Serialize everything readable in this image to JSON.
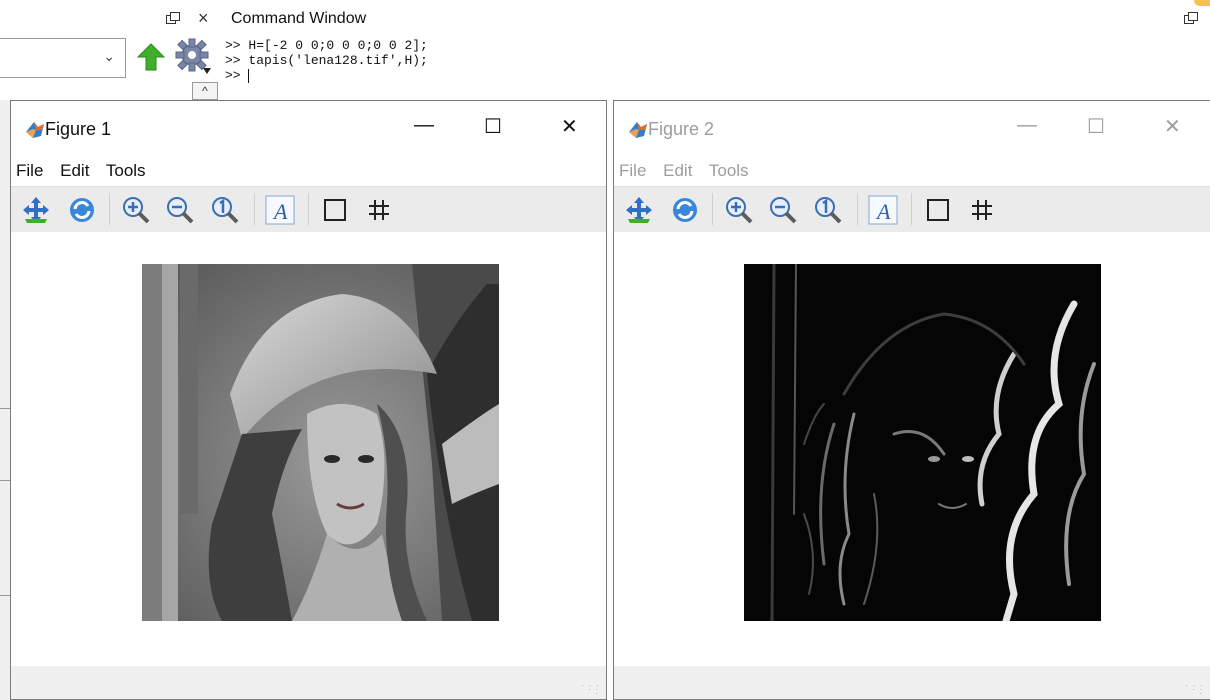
{
  "command_window": {
    "title": "Command Window",
    "close_glyph": "×",
    "lines": [
      "H=[-2 0 0;0 0 0;0 0 2];",
      "tapis('lena128.tif',H);",
      ""
    ],
    "prompt": ">>",
    "scroll_up_glyph": "^",
    "dropdown_glyph": "⌄"
  },
  "figures": [
    {
      "title": "Figure 1",
      "active": true,
      "menu": [
        "File",
        "Edit",
        "Tools"
      ],
      "image": {
        "name": "lena-original",
        "tone": "grayscale"
      }
    },
    {
      "title": "Figure 2",
      "active": false,
      "menu": [
        "File",
        "Edit",
        "Tools"
      ],
      "image": {
        "name": "lena-filtered",
        "tone": "edge-response"
      }
    }
  ],
  "window_controls": {
    "minimize": "—",
    "maximize": "☐",
    "close": "✕"
  },
  "toolbar_icons": [
    "pan-icon",
    "rotate-icon",
    "zoom-in-icon",
    "zoom-out-icon",
    "zoom-reset-icon",
    "insert-text-icon",
    "rectangle-icon",
    "grid-icon"
  ],
  "colors": {
    "accent_arrow": "#3fae2a",
    "gear": "#6f7fa8",
    "background": "#ffffff",
    "toolbar": "#ebebeb"
  }
}
